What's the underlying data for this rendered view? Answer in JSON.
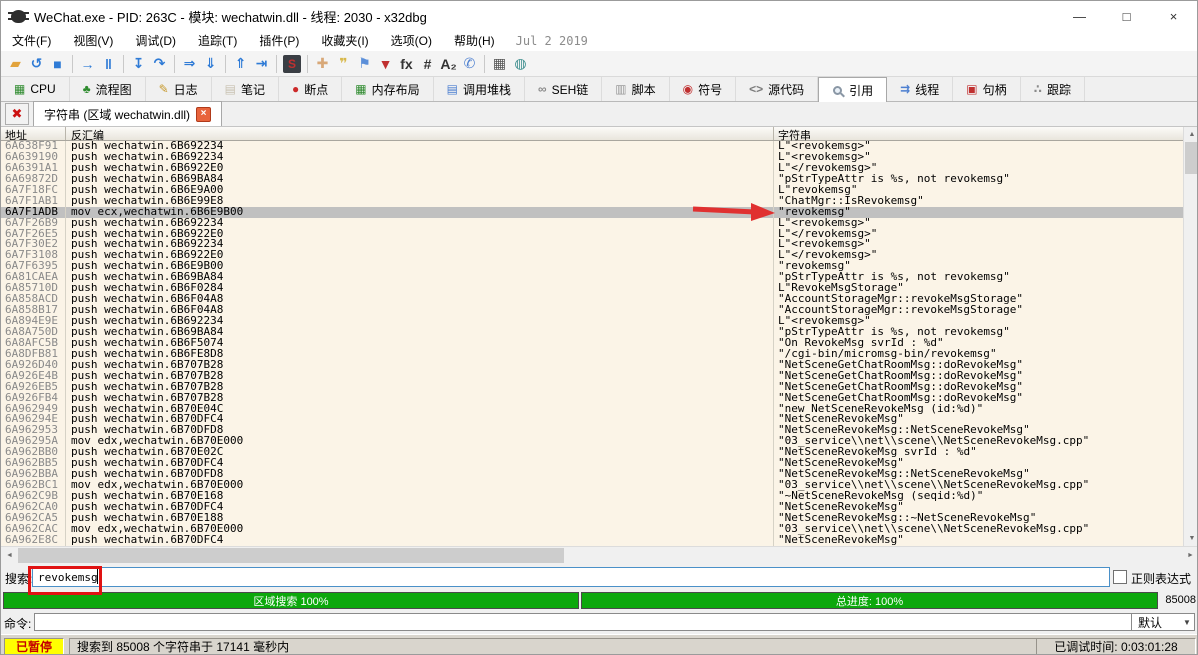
{
  "window": {
    "title": "WeChat.exe - PID: 263C - 模块: wechatwin.dll - 线程: 2030 - x32dbg",
    "controls": {
      "minimize": "—",
      "maximize": "□",
      "close": "×"
    }
  },
  "menubar": {
    "items": [
      "文件(F)",
      "视图(V)",
      "调试(D)",
      "追踪(T)",
      "插件(P)",
      "收藏夹(I)",
      "选项(O)",
      "帮助(H)"
    ],
    "build_date": "Jul 2 2019"
  },
  "toolbar": {
    "groups": [
      [
        {
          "name": "open-file-icon",
          "glyph": "▰",
          "color": "#E2A33C"
        },
        {
          "name": "restart-icon",
          "glyph": "↺",
          "color": "#2F7BD6"
        },
        {
          "name": "stop-icon",
          "glyph": "■",
          "color": "#2F7BD6"
        }
      ],
      [
        {
          "name": "run-icon",
          "glyph": "→",
          "color": "#2F7BD6"
        },
        {
          "name": "pause-icon",
          "glyph": "‖",
          "color": "#2F7BD6"
        }
      ],
      [
        {
          "name": "step-into-icon",
          "glyph": "↧",
          "color": "#2F7BD6"
        },
        {
          "name": "step-over-icon",
          "glyph": "↷",
          "color": "#2F7BD6"
        }
      ],
      [
        {
          "name": "run-to-icon",
          "glyph": "⇒",
          "color": "#2F7BD6"
        },
        {
          "name": "execute-till-return-icon",
          "glyph": "⇓",
          "color": "#2F7BD6"
        }
      ],
      [
        {
          "name": "step-out-icon",
          "glyph": "⇑",
          "color": "#2F7BD6"
        },
        {
          "name": "run-to-user-code-icon",
          "glyph": "⇥",
          "color": "#2F7BD6"
        }
      ],
      [
        {
          "name": "seh-chain-icon",
          "glyph": "S",
          "color": "#C03030",
          "dark": true
        }
      ],
      [
        {
          "name": "patch-icon",
          "glyph": "✚",
          "color": "#D8A878"
        },
        {
          "name": "comment-icon",
          "glyph": "❞",
          "color": "#D8B84A"
        },
        {
          "name": "label-icon",
          "glyph": "⚑",
          "color": "#5B8FD9"
        },
        {
          "name": "bookmark-icon",
          "glyph": "▼",
          "color": "#C03030"
        },
        {
          "name": "function-icon",
          "glyph": "fx",
          "color": "#333333"
        },
        {
          "name": "hash-icon",
          "glyph": "#",
          "color": "#333333"
        },
        {
          "name": "strings-icon",
          "glyph": "A₂",
          "color": "#333333"
        },
        {
          "name": "report-icon",
          "glyph": "✆",
          "color": "#4C7FD0"
        }
      ],
      [
        {
          "name": "calculator-icon",
          "glyph": "▦",
          "color": "#555555"
        },
        {
          "name": "globe-icon",
          "glyph": "◍",
          "color": "#3C8D8D"
        }
      ]
    ]
  },
  "tabbar": {
    "tabs": [
      {
        "name": "tab-cpu",
        "label": "CPU",
        "glyph": "▦",
        "color": "#2E8B2E",
        "selected": false
      },
      {
        "name": "tab-graph",
        "label": "流程图",
        "glyph": "♣",
        "color": "#2E8B2E",
        "selected": false
      },
      {
        "name": "tab-log",
        "label": "日志",
        "glyph": "✎",
        "color": "#C79A2E",
        "selected": false
      },
      {
        "name": "tab-notes",
        "label": "笔记",
        "glyph": "▤",
        "color": "#C9C2B2",
        "selected": false
      },
      {
        "name": "tab-breakpoints",
        "label": "断点",
        "glyph": "●",
        "color": "#CC2A2A",
        "selected": false
      },
      {
        "name": "tab-memory-map",
        "label": "内存布局",
        "glyph": "▦",
        "color": "#2E8B2E",
        "selected": false
      },
      {
        "name": "tab-call-stack",
        "label": "调用堆栈",
        "glyph": "▤",
        "color": "#4C7FD0",
        "selected": false
      },
      {
        "name": "tab-seh",
        "label": "SEH链",
        "glyph": "∞",
        "color": "#8A8A8A",
        "selected": false
      },
      {
        "name": "tab-script",
        "label": "脚本",
        "glyph": "▥",
        "color": "#9A9A9A",
        "selected": false
      },
      {
        "name": "tab-symbols",
        "label": "符号",
        "glyph": "◉",
        "color": "#C03030",
        "selected": false
      },
      {
        "name": "tab-source",
        "label": "源代码",
        "glyph": "<>",
        "color": "#7A7A7A",
        "selected": false
      },
      {
        "name": "tab-references",
        "label": "引用",
        "glyph": "mag",
        "color": "#8A97A5",
        "selected": true
      },
      {
        "name": "tab-threads",
        "label": "线程",
        "glyph": "⇉",
        "color": "#4C7FD0",
        "selected": false
      },
      {
        "name": "tab-handles",
        "label": "句柄",
        "glyph": "▣",
        "color": "#C03030",
        "selected": false
      },
      {
        "name": "tab-trace",
        "label": "跟踪",
        "glyph": "∴",
        "color": "#8A8A8A",
        "selected": false
      }
    ]
  },
  "subtab": {
    "label": "字符串 (区域 wechatwin.dll)",
    "close_glyph": "×",
    "panel_close_glyph": "✖"
  },
  "strings_table": {
    "columns": [
      "地址",
      "反汇编",
      "字符串"
    ],
    "highlight_term": "revokemsg",
    "highlight_color": "#EE0000",
    "selected_index": 6,
    "rows": [
      [
        "6A638F91",
        "push wechatwin.6B692234",
        "L\"<revokemsg>\""
      ],
      [
        "6A639190",
        "push wechatwin.6B692234",
        "L\"<revokemsg>\""
      ],
      [
        "6A6391A1",
        "push wechatwin.6B6922E0",
        "L\"</revokemsg>\""
      ],
      [
        "6A69872D",
        "push wechatwin.6B69BA84",
        "\"pStrTypeAttr is %s, not revokemsg\""
      ],
      [
        "6A7F18FC",
        "push wechatwin.6B6E9A00",
        "L\"revokemsg\""
      ],
      [
        "6A7F1AB1",
        "push wechatwin.6B6E99E8",
        "\"ChatMgr::IsRevokemsg\""
      ],
      [
        "6A7F1ADB",
        "mov ecx,wechatwin.6B6E9B00",
        "\"revokemsg\""
      ],
      [
        "6A7F26B9",
        "push wechatwin.6B692234",
        "L\"<revokemsg>\""
      ],
      [
        "6A7F26E5",
        "push wechatwin.6B6922E0",
        "L\"</revokemsg>\""
      ],
      [
        "6A7F30E2",
        "push wechatwin.6B692234",
        "L\"<revokemsg>\""
      ],
      [
        "6A7F3108",
        "push wechatwin.6B6922E0",
        "L\"</revokemsg>\""
      ],
      [
        "6A7F6395",
        "push wechatwin.6B6E9B00",
        "\"revokemsg\""
      ],
      [
        "6A81CAEA",
        "push wechatwin.6B69BA84",
        "\"pStrTypeAttr is %s, not revokemsg\""
      ],
      [
        "6A85710D",
        "push wechatwin.6B6F0284",
        "L\"RevokeMsgStorage\""
      ],
      [
        "6A858ACD",
        "push wechatwin.6B6F04A8",
        "\"AccountStorageMgr::revokeMsgStorage\""
      ],
      [
        "6A858B17",
        "push wechatwin.6B6F04A8",
        "\"AccountStorageMgr::revokeMsgStorage\""
      ],
      [
        "6A894E9E",
        "push wechatwin.6B692234",
        "L\"<revokemsg>\""
      ],
      [
        "6A8A750D",
        "push wechatwin.6B69BA84",
        "\"pStrTypeAttr is %s, not revokemsg\""
      ],
      [
        "6A8AFC5B",
        "push wechatwin.6B6F5074",
        "\"On RevokeMsg svrId : %d\""
      ],
      [
        "6A8DFB81",
        "push wechatwin.6B6FE8D8",
        "\"/cgi-bin/micromsg-bin/revokemsg\""
      ],
      [
        "6A926D40",
        "push wechatwin.6B707B28",
        "\"NetSceneGetChatRoomMsg::doRevokeMsg\""
      ],
      [
        "6A926E4B",
        "push wechatwin.6B707B28",
        "\"NetSceneGetChatRoomMsg::doRevokeMsg\""
      ],
      [
        "6A926EB5",
        "push wechatwin.6B707B28",
        "\"NetSceneGetChatRoomMsg::doRevokeMsg\""
      ],
      [
        "6A926FB4",
        "push wechatwin.6B707B28",
        "\"NetSceneGetChatRoomMsg::doRevokeMsg\""
      ],
      [
        "6A962949",
        "push wechatwin.6B70E04C",
        "\"new NetSceneRevokeMsg (id:%d)\""
      ],
      [
        "6A96294E",
        "push wechatwin.6B70DFC4",
        "\"NetSceneRevokeMsg\""
      ],
      [
        "6A962953",
        "push wechatwin.6B70DFD8",
        "\"NetSceneRevokeMsg::NetSceneRevokeMsg\""
      ],
      [
        "6A96295A",
        "mov edx,wechatwin.6B70E000",
        "\"03_service\\\\net\\\\scene\\\\NetSceneRevokeMsg.cpp\""
      ],
      [
        "6A962BB0",
        "push wechatwin.6B70E02C",
        "\"NetSceneRevokeMsg svrId : %d\""
      ],
      [
        "6A962BB5",
        "push wechatwin.6B70DFC4",
        "\"NetSceneRevokeMsg\""
      ],
      [
        "6A962BBA",
        "push wechatwin.6B70DFD8",
        "\"NetSceneRevokeMsg::NetSceneRevokeMsg\""
      ],
      [
        "6A962BC1",
        "mov edx,wechatwin.6B70E000",
        "\"03_service\\\\net\\\\scene\\\\NetSceneRevokeMsg.cpp\""
      ],
      [
        "6A962C9B",
        "push wechatwin.6B70E168",
        "\"~NetSceneRevokeMsg (seqid:%d)\""
      ],
      [
        "6A962CA0",
        "push wechatwin.6B70DFC4",
        "\"NetSceneRevokeMsg\""
      ],
      [
        "6A962CA5",
        "push wechatwin.6B70E188",
        "\"NetSceneRevokeMsg::~NetSceneRevokeMsg\""
      ],
      [
        "6A962CAC",
        "mov edx,wechatwin.6B70E000",
        "\"03_service\\\\net\\\\scene\\\\NetSceneRevokeMsg.cpp\""
      ],
      [
        "6A962E8C",
        "push wechatwin.6B70DFC4",
        "\"NetSceneRevokeMsg\""
      ]
    ]
  },
  "search": {
    "label": "搜索:",
    "value": "revokemsg",
    "regex_label": "正则表达式",
    "regex_checked": false
  },
  "progress": {
    "region_label": "区域搜索  100%",
    "total_label": "总进度:  100%",
    "count": "85008",
    "bar_color": "#0CA80C"
  },
  "command": {
    "label": "命令:",
    "value": "",
    "profile": "默认"
  },
  "statusbar": {
    "state": "已暂停",
    "message": "搜索到 85008 个字符串于 17141 毫秒内",
    "time_label": "已调试时间:  0:03:01:28"
  }
}
